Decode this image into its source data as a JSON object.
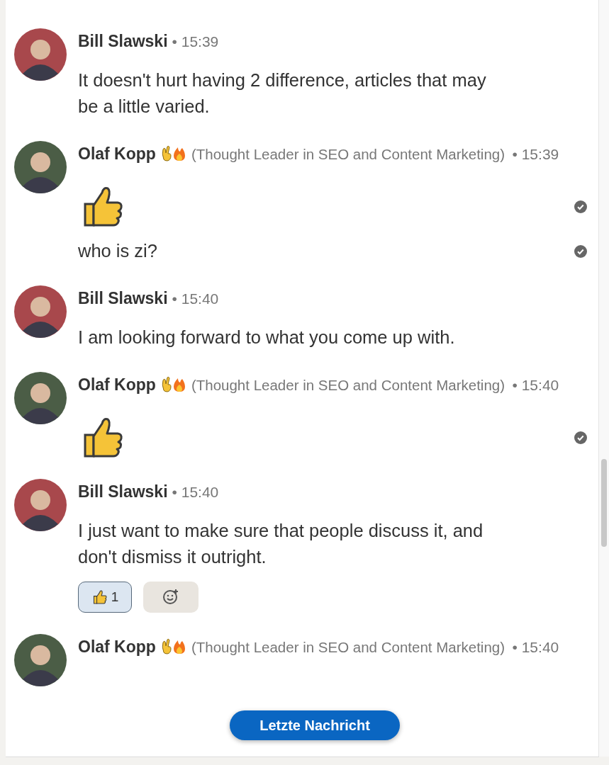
{
  "groups": [
    {
      "author": "Bill Slawski",
      "color": "#a8484c",
      "badges": false,
      "time": "• 15:39",
      "messages": [
        {
          "kind": "text",
          "text": "It doesn't hurt having 2 difference, articles that may\nbe a little varied.",
          "read": false
        }
      ]
    },
    {
      "author": "Olaf Kopp",
      "color": "#4b5d46",
      "badges": true,
      "headline": "(Thought Leader in SEO and Content Marketing)",
      "time": "• 15:39",
      "messages": [
        {
          "kind": "thumbs",
          "read": true
        },
        {
          "kind": "text",
          "text": "who is zi?",
          "read": true
        }
      ]
    },
    {
      "author": "Bill Slawski",
      "color": "#a8484c",
      "badges": false,
      "time": "• 15:40",
      "messages": [
        {
          "kind": "text",
          "text": "I am looking forward to what you come up with.",
          "read": false
        }
      ]
    },
    {
      "author": "Olaf Kopp",
      "color": "#4b5d46",
      "badges": true,
      "headline": "(Thought Leader in SEO and Content Marketing)",
      "time": "• 15:40",
      "messages": [
        {
          "kind": "thumbs",
          "read": true
        }
      ]
    },
    {
      "author": "Bill Slawski",
      "color": "#a8484c",
      "badges": false,
      "time": "• 15:40",
      "messages": [
        {
          "kind": "text",
          "text": "I just want to make sure that people discuss it, and\ndon't dismiss it outright.",
          "read": false
        }
      ],
      "reactions": [
        {
          "count": "1",
          "selected": true
        }
      ]
    },
    {
      "author": "Olaf Kopp",
      "color": "#4b5d46",
      "badges": true,
      "headline": "(Thought Leader in SEO and Content Marketing)",
      "time": "• 15:40"
    }
  ],
  "jump_button": "Letzte Nachricht"
}
